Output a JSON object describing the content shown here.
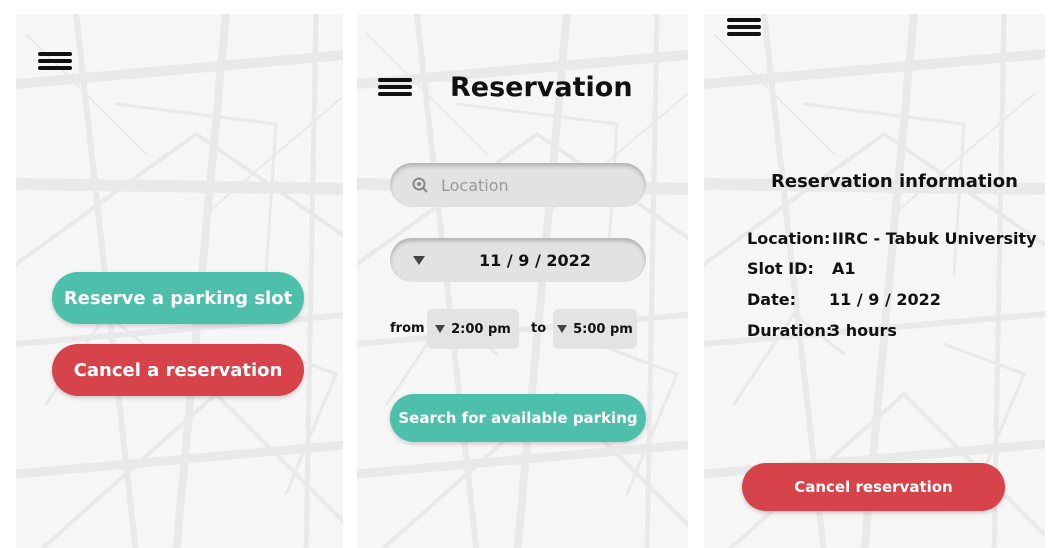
{
  "screen_home": {
    "reserve_button": "Reserve a parking slot",
    "cancel_button": "Cancel a reservation"
  },
  "screen_reservation": {
    "title": "Reservation",
    "location_placeholder": "Location",
    "date_value": "11 / 9 / 2022",
    "from_label": "from",
    "from_time": "2:00 pm",
    "to_label": "to",
    "to_time": "5:00 pm",
    "search_button": "Search for available parking"
  },
  "screen_info": {
    "title": "Reservation information",
    "rows": [
      {
        "key": "Location:",
        "value": "IIRC - Tabuk University"
      },
      {
        "key": "Slot ID:",
        "value": "A1"
      },
      {
        "key": "Date:",
        "value": "11 / 9 / 2022"
      },
      {
        "key": "Duration:",
        "value": "3 hours"
      }
    ],
    "cancel_button": "Cancel reservation"
  },
  "colors": {
    "teal": "#4dbfaa",
    "red": "#d6434a",
    "field": "#e2e2e2",
    "background": "#f6f6f6"
  },
  "icons": [
    "menu-icon",
    "search-location-icon",
    "dropdown-triangle-icon"
  ]
}
